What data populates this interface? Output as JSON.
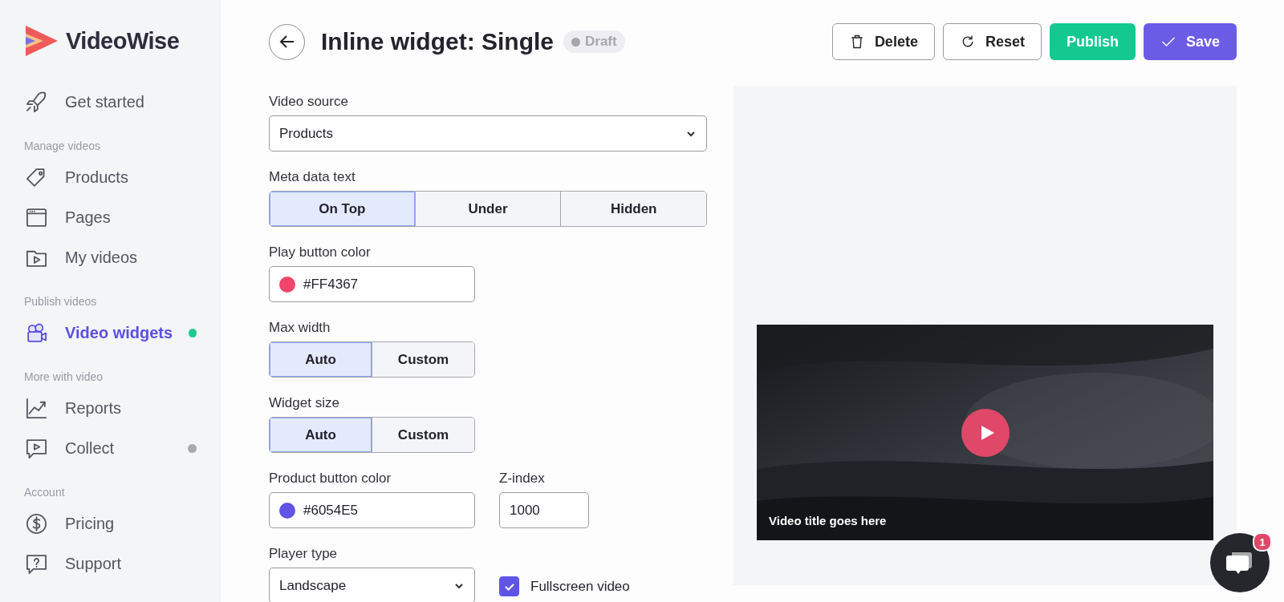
{
  "sidebar": {
    "logo": "VideoWise",
    "items": [
      {
        "kind": "item",
        "label": "Get started",
        "selected": false
      },
      {
        "kind": "section",
        "label": "Manage videos"
      },
      {
        "kind": "item",
        "label": "Products",
        "selected": false
      },
      {
        "kind": "item",
        "label": "Pages",
        "selected": false
      },
      {
        "kind": "item",
        "label": "My videos",
        "selected": false
      },
      {
        "kind": "section",
        "label": "Publish videos"
      },
      {
        "kind": "item",
        "label": "Video widgets",
        "selected": true,
        "color": "#1fc98e"
      },
      {
        "kind": "section",
        "label": "More with video"
      },
      {
        "kind": "item",
        "label": "Reports",
        "selected": false
      },
      {
        "kind": "item",
        "label": "Collect",
        "selected": false,
        "color": "#a9a9b3"
      },
      {
        "kind": "section",
        "label": "Account"
      },
      {
        "kind": "item",
        "label": "Pricing",
        "selected": false
      },
      {
        "kind": "item",
        "label": "Support",
        "selected": false
      }
    ]
  },
  "header": {
    "title": "Inline widget: Single",
    "status": "Draft",
    "actions": [
      {
        "label": "Delete",
        "kind": "outline"
      },
      {
        "label": "Reset",
        "kind": "outline"
      },
      {
        "label": "Publish",
        "kind": "success"
      },
      {
        "label": "Save",
        "kind": "primary"
      }
    ]
  },
  "form": [
    {
      "kind": "select",
      "label": "Video source",
      "value": "Products"
    },
    {
      "kind": "segmented",
      "label": "Meta data text",
      "options": [
        {
          "label": "On Top",
          "selected": true
        },
        {
          "label": "Under",
          "selected": false
        },
        {
          "label": "Hidden",
          "selected": false
        }
      ]
    },
    {
      "kind": "color",
      "label": "Play button color",
      "value": "#FF4367",
      "color": "#f04468"
    },
    {
      "kind": "segmented",
      "label": "Max width",
      "options": [
        {
          "label": "Auto",
          "selected": true
        },
        {
          "label": "Custom",
          "selected": false
        }
      ]
    },
    {
      "kind": "segmented",
      "label": "Widget size",
      "options": [
        {
          "label": "Auto",
          "selected": true
        },
        {
          "label": "Custom",
          "selected": false
        }
      ]
    },
    {
      "kind": "row",
      "children": [
        {
          "kind": "color",
          "label": "Product button color",
          "value": "#6054E5",
          "color": "#6054e5"
        },
        {
          "kind": "number",
          "label": "Z-index",
          "value": "1000"
        }
      ]
    },
    {
      "kind": "row",
      "children": [
        {
          "kind": "select",
          "label": "Player type",
          "value": "Landscape"
        },
        {
          "kind": "checkbox",
          "label": "Fullscreen video",
          "checked": true
        }
      ]
    }
  ],
  "preview": {
    "video_title": "Video title goes here"
  },
  "chat": {
    "badge": "1"
  }
}
